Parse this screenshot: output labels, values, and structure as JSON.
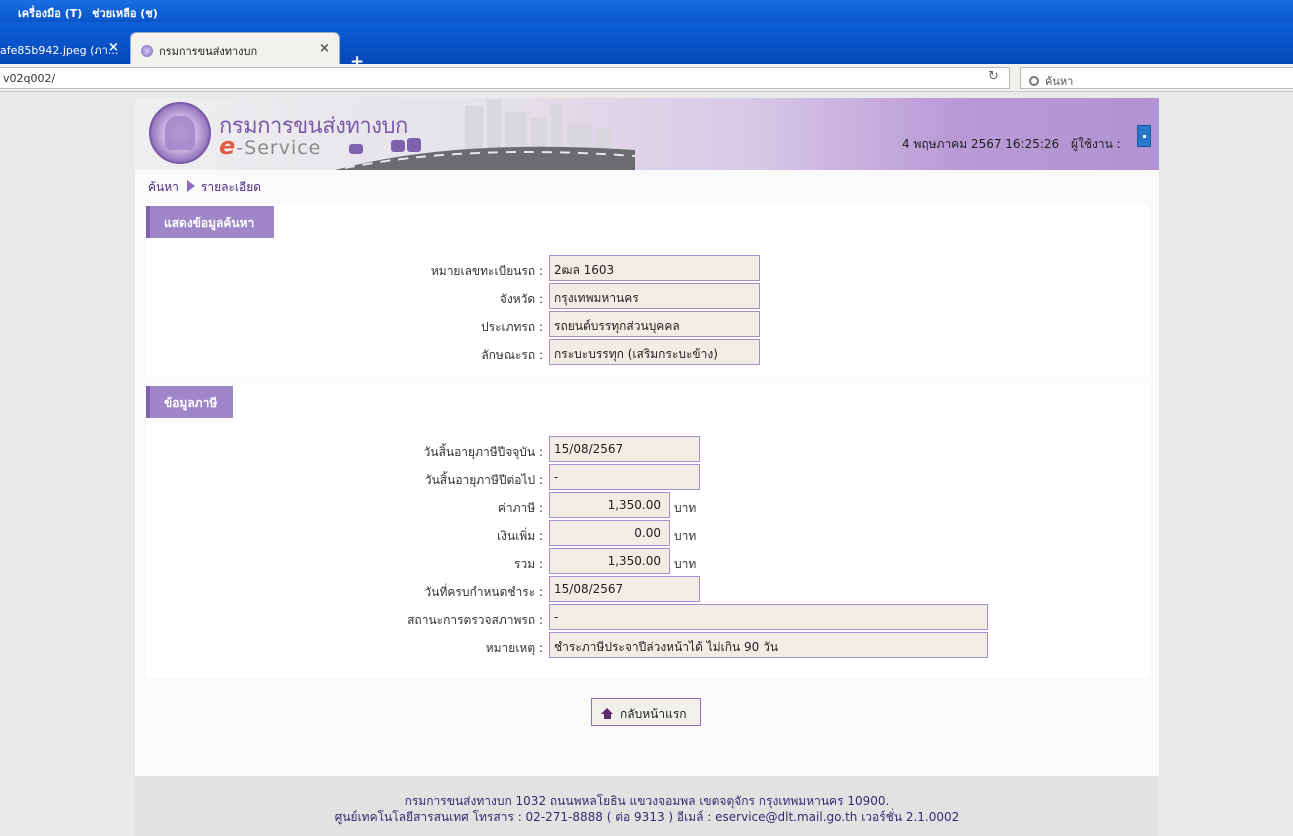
{
  "browser": {
    "menu": [
      "เครื่องมือ (T)",
      "ช่วยเหลือ (ช)"
    ],
    "tabs": [
      {
        "title": "afe85b942.jpeg (ภา..."
      },
      {
        "title": "กรมการขนส่งทางบก"
      }
    ],
    "new_tab_label": "+",
    "url": "v02q002/",
    "search_placeholder": "ค้นหา"
  },
  "header": {
    "dept_name": "กรมการขนส่งทางบก",
    "service_e": "e",
    "service_rest": "-Service",
    "datetime": "4 พฤษภาคม 2567 16:25:26",
    "user_label": "ผู้ใช้งาน :"
  },
  "breadcrumb": {
    "search": "ค้นหา",
    "detail": "รายละเอียด"
  },
  "search_section": {
    "title": "แสดงข้อมูลค้นหา",
    "rows": [
      {
        "label": "หมายเลขทะเบียนรถ :",
        "value": "2ฒล 1603"
      },
      {
        "label": "จังหวัด :",
        "value": "กรุงเทพมหานคร"
      },
      {
        "label": "ประเภทรถ :",
        "value": "รถยนต์บรรทุกส่วนบุคคล"
      },
      {
        "label": "ลักษณะรถ :",
        "value": "กระบะบรรทุก (เสริมกระบะข้าง)"
      }
    ]
  },
  "tax_section": {
    "title": "ข้อมูลภาษี",
    "expiry_current": {
      "label": "วันสิ้นอายุภาษีปีจจุบัน :",
      "value": "15/08/2567"
    },
    "expiry_next": {
      "label": "วันสิ้นอายุภาษีปีต่อไป :",
      "value": "-"
    },
    "tax": {
      "label": "ค่าภาษี :",
      "value": "1,350.00",
      "unit": "บาท"
    },
    "surcharge": {
      "label": "เงินเพิ่ม :",
      "value": "0.00",
      "unit": "บาท"
    },
    "total": {
      "label": "รวม :",
      "value": "1,350.00",
      "unit": "บาท"
    },
    "due_date": {
      "label": "วันที่ครบกำหนดชำระ :",
      "value": "15/08/2567"
    },
    "inspection": {
      "label": "สถานะการตรวจสภาพรถ :",
      "value": "-"
    },
    "remark": {
      "label": "หมายเหตุ :",
      "value": "ชำระภาษีประจาปีล่วงหน้าได้ ไม่เกิน 90 วัน"
    }
  },
  "home_button": "กลับหน้าแรก",
  "footer": {
    "line1": "กรมการขนส่งทางบก 1032 ถนนพหลโยธิน แขวงจอมพล เขตจตุจักร กรุงเทพมหานคร 10900.",
    "line2": "ศูนย์เทคโนโลยีสารสนเทศ โทรสาร : 02-271-8888 ( ต่อ 9313 ) อีเมล์ : eservice@dlt.mail.go.th เวอร์ชั่น 2.1.0002"
  }
}
